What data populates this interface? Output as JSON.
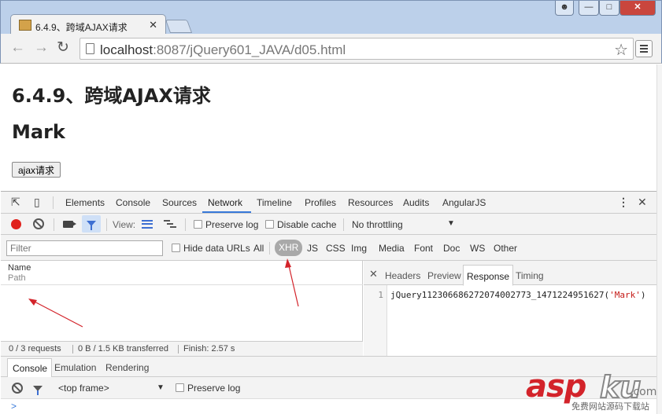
{
  "browser": {
    "tab_title": "6.4.9、跨域AJAX请求",
    "url_host": "localhost",
    "url_path": ":8087/jQuery601_JAVA/d05.html"
  },
  "page": {
    "heading": "6.4.9、跨域AJAX请求",
    "name": "Mark",
    "button_label": "ajax请求"
  },
  "devtools": {
    "panels": [
      "Elements",
      "Console",
      "Sources",
      "Network",
      "Timeline",
      "Profiles",
      "Resources",
      "Audits",
      "AngularJS"
    ],
    "active_panel": "Network",
    "network_toolbar": {
      "view_label": "View:",
      "preserve_log": "Preserve log",
      "disable_cache": "Disable cache",
      "throttling": "No throttling"
    },
    "filter_bar": {
      "placeholder": "Filter",
      "hide_data_urls": "Hide data URLs",
      "types": [
        "All",
        "XHR",
        "JS",
        "CSS",
        "Img",
        "Media",
        "Font",
        "Doc",
        "WS",
        "Other"
      ],
      "active_type": "XHR"
    },
    "request_list": {
      "col_name": "Name",
      "col_path": "Path"
    },
    "detail_tabs": [
      "Headers",
      "Preview",
      "Response",
      "Timing"
    ],
    "active_detail_tab": "Response",
    "response": {
      "line_number": "1",
      "callback": "jQuery112306686272074002773_1471224951627(",
      "argument": "'Mark'",
      "close_paren": ")"
    },
    "status": {
      "requests": "0 / 3 requests",
      "transferred": "0 B / 1.5 KB transferred",
      "finish": "Finish: 2.57 s"
    },
    "drawer_tabs": [
      "Console",
      "Emulation",
      "Rendering"
    ],
    "active_drawer_tab": "Console",
    "console": {
      "context": "<top frame>",
      "preserve_log": "Preserve log",
      "prompt": ">"
    }
  },
  "watermark": {
    "brand_red": "asp",
    "brand_outline": "ku",
    "tld": ".com",
    "subtitle": "免费网站源码下载站"
  },
  "colors": {
    "record_red": "#e0211c",
    "accent_blue": "#3879d9",
    "annotation_red": "#d3232a"
  }
}
